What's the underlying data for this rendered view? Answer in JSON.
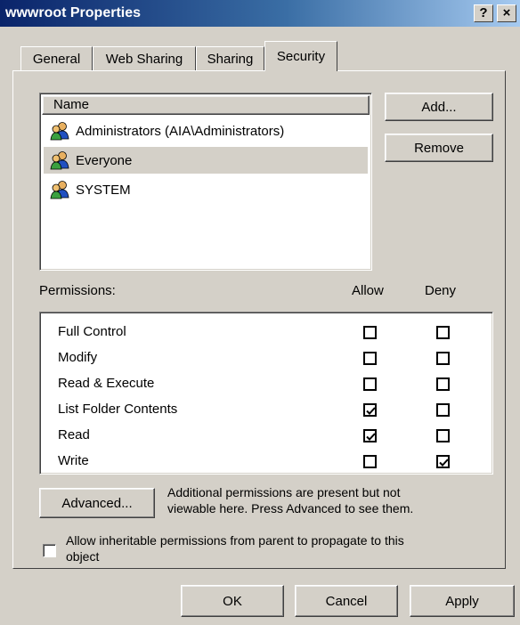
{
  "window": {
    "title": "wwwroot Properties",
    "help_label": "?",
    "close_label": "×"
  },
  "tabs": [
    {
      "label": "General"
    },
    {
      "label": "Web Sharing"
    },
    {
      "label": "Sharing"
    },
    {
      "label": "Security",
      "active": true
    }
  ],
  "users": {
    "header": "Name",
    "items": [
      {
        "name": "Administrators (AIA\\Administrators)",
        "icon": "user-group-icon"
      },
      {
        "name": "Everyone",
        "icon": "user-group-icon",
        "selected": true
      },
      {
        "name": "SYSTEM",
        "icon": "user-group-icon"
      }
    ],
    "add_label": "Add...",
    "remove_label": "Remove"
  },
  "permissions": {
    "label": "Permissions:",
    "allow_header": "Allow",
    "deny_header": "Deny",
    "rows": [
      {
        "name": "Full Control",
        "allow": false,
        "deny": false
      },
      {
        "name": "Modify",
        "allow": false,
        "deny": false
      },
      {
        "name": "Read & Execute",
        "allow": false,
        "deny": false
      },
      {
        "name": "List Folder Contents",
        "allow": true,
        "deny": false
      },
      {
        "name": "Read",
        "allow": true,
        "deny": false
      },
      {
        "name": "Write",
        "allow": false,
        "deny": true
      }
    ]
  },
  "advanced": {
    "button_label": "Advanced...",
    "note_line1": "Additional permissions are present but not",
    "note_line2": "viewable here. Press Advanced to see them."
  },
  "inherit": {
    "checked": false,
    "line1": "Allow inheritable permissions from parent to propagate to this",
    "line2": "object"
  },
  "footer": {
    "ok_label": "OK",
    "cancel_label": "Cancel",
    "apply_label": "Apply"
  },
  "colors": {
    "title_start": "#0a246a",
    "title_end": "#a6caf0",
    "face": "#d4d0c8"
  }
}
